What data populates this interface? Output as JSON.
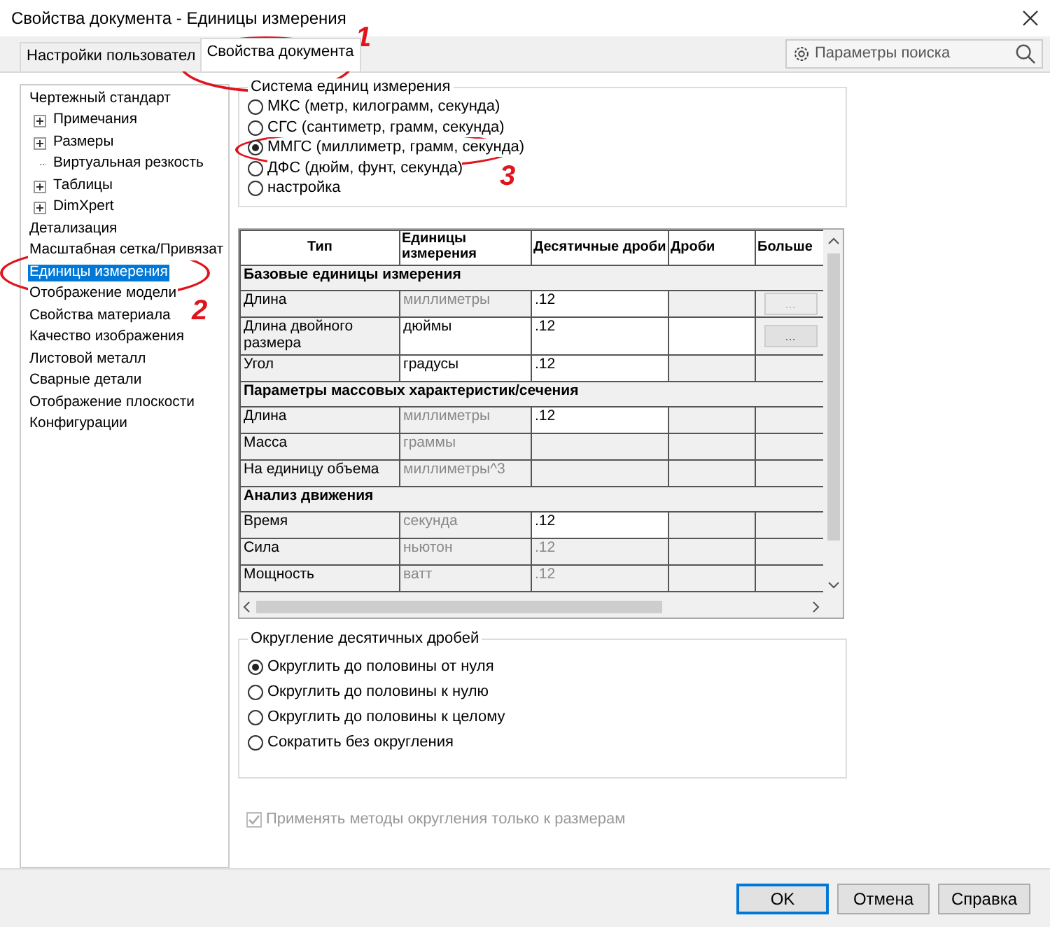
{
  "window": {
    "title": "Свойства документа - Единицы измерения"
  },
  "tabs": [
    {
      "label": "Настройки пользовател",
      "selected": false
    },
    {
      "label": "Свойства документа",
      "selected": true
    }
  ],
  "search": {
    "placeholder": "Параметры поиска"
  },
  "sidebar": {
    "items": [
      {
        "label": "Чертежный стандарт",
        "selected": false,
        "children": [
          {
            "label": "Примечания",
            "kind": "collapsed",
            "selected": false
          },
          {
            "label": "Размеры",
            "kind": "collapsed",
            "selected": false
          },
          {
            "label": "Виртуальная резкость",
            "kind": "leaf",
            "selected": false
          },
          {
            "label": "Таблицы",
            "kind": "collapsed",
            "selected": false
          },
          {
            "label": "DimXpert",
            "kind": "collapsed",
            "selected": false
          }
        ]
      },
      {
        "label": "Детализация",
        "selected": false
      },
      {
        "label": "Масштабная сетка/Привязат",
        "selected": false
      },
      {
        "label": "Единицы измерения",
        "selected": true
      },
      {
        "label": "Отображение модели",
        "selected": false
      },
      {
        "label": "Свойства материала",
        "selected": false
      },
      {
        "label": "Качество изображения",
        "selected": false
      },
      {
        "label": "Листовой металл",
        "selected": false
      },
      {
        "label": "Сварные детали",
        "selected": false
      },
      {
        "label": "Отображение плоскости",
        "selected": false
      },
      {
        "label": "Конфигурации",
        "selected": false
      }
    ]
  },
  "unit_system": {
    "title": "Система единиц измерения",
    "options": [
      {
        "label": "МКС (метр, килограмм, секунда)",
        "selected": false
      },
      {
        "label": "СГС (сантиметр, грамм, секунда)",
        "selected": false
      },
      {
        "label": "ММГС (миллиметр, грамм, секунда)",
        "selected": true
      },
      {
        "label": "ДФС (дюйм, фунт, секунда)",
        "selected": false
      },
      {
        "label": "настройка",
        "selected": false
      }
    ]
  },
  "table": {
    "columns": [
      "Тип",
      "Единицы измерения",
      "Десятичные дроби",
      "Дроби",
      "Больше"
    ],
    "rows": [
      {
        "kind": "section",
        "label": "Базовые единицы измерения"
      },
      {
        "kind": "row",
        "cells": [
          {
            "text": "Длина"
          },
          {
            "text": "миллиметры",
            "editable": false
          },
          {
            "text": ".12",
            "editable": true
          },
          {
            "editable": false
          },
          {
            "kind": "button",
            "text": "...",
            "disabled": true
          }
        ]
      },
      {
        "kind": "row",
        "cells": [
          {
            "text": "Длина двойного размера"
          },
          {
            "text": "дюймы",
            "editable": true
          },
          {
            "text": ".12",
            "editable": true
          },
          {
            "editable": true
          },
          {
            "kind": "button",
            "text": "...",
            "disabled": false
          }
        ]
      },
      {
        "kind": "row",
        "cells": [
          {
            "text": "Угол"
          },
          {
            "text": "градусы",
            "editable": true
          },
          {
            "text": ".12",
            "editable": true
          },
          {
            "editable": false
          },
          {
            "editable": false
          }
        ]
      },
      {
        "kind": "section",
        "label": "Параметры массовых характеристик/сечения"
      },
      {
        "kind": "row",
        "cells": [
          {
            "text": "Длина"
          },
          {
            "text": "миллиметры",
            "editable": false
          },
          {
            "text": ".12",
            "editable": true
          },
          {
            "editable": false
          },
          {
            "editable": false
          }
        ]
      },
      {
        "kind": "row",
        "cells": [
          {
            "text": "Масса"
          },
          {
            "text": "граммы",
            "editable": false
          },
          {
            "editable": false
          },
          {
            "editable": false
          },
          {
            "editable": false
          }
        ]
      },
      {
        "kind": "row",
        "cells": [
          {
            "text": "На единицу объема"
          },
          {
            "text": "миллиметры^3",
            "editable": false
          },
          {
            "editable": false
          },
          {
            "editable": false
          },
          {
            "editable": false
          }
        ]
      },
      {
        "kind": "section",
        "label": "Анализ движения"
      },
      {
        "kind": "row",
        "cells": [
          {
            "text": "Время"
          },
          {
            "text": "секунда",
            "editable": false
          },
          {
            "text": ".12",
            "editable": true
          },
          {
            "editable": false
          },
          {
            "editable": false
          }
        ]
      },
      {
        "kind": "row",
        "cells": [
          {
            "text": "Сила"
          },
          {
            "text": "ньютон",
            "editable": false
          },
          {
            "text": ".12",
            "editable": false
          },
          {
            "editable": false
          },
          {
            "editable": false
          }
        ]
      },
      {
        "kind": "row",
        "cells": [
          {
            "text": "Мощность"
          },
          {
            "text": "ватт",
            "editable": false
          },
          {
            "text": ".12",
            "editable": false
          },
          {
            "editable": false
          },
          {
            "editable": false
          }
        ]
      }
    ]
  },
  "rounding": {
    "title": "Округление десятичных дробей",
    "options": [
      {
        "label": "Округлить до половины от нуля",
        "selected": true
      },
      {
        "label": "Округлить до половины к нулю",
        "selected": false
      },
      {
        "label": "Округлить до половины к целому",
        "selected": false
      },
      {
        "label": "Сократить без округления",
        "selected": false
      }
    ]
  },
  "apply_checkbox": {
    "label": "Применять методы округления только к размерам",
    "checked": true,
    "disabled": true
  },
  "buttons": [
    {
      "label": "OK",
      "default": true
    },
    {
      "label": "Отмена",
      "default": false
    },
    {
      "label": "Справка",
      "default": false
    }
  ],
  "annotations": [
    {
      "label": "1"
    },
    {
      "label": "2"
    },
    {
      "label": "3"
    }
  ]
}
